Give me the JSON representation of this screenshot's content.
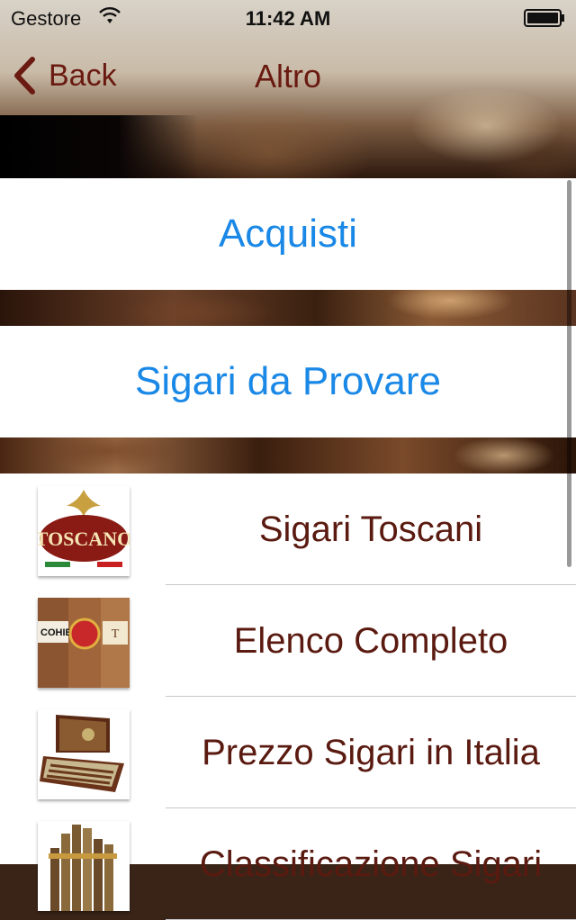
{
  "status_bar": {
    "carrier": "Gestore",
    "time": "11:42 AM"
  },
  "nav": {
    "back_label": "Back",
    "title": "Altro"
  },
  "buttons": {
    "acquisti": "Acquisti",
    "provare": "Sigari da Provare"
  },
  "list": [
    {
      "label": "Sigari Toscani",
      "icon": "toscano-logo-icon"
    },
    {
      "label": "Elenco Completo",
      "icon": "cigar-bands-icon"
    },
    {
      "label": "Prezzo Sigari in Italia",
      "icon": "humidor-icon"
    },
    {
      "label": "Classificazione Sigari",
      "icon": "cigar-bundle-icon"
    }
  ],
  "colors": {
    "accent_blue": "#1a88e6",
    "nav_maroon": "#6a1a10"
  }
}
